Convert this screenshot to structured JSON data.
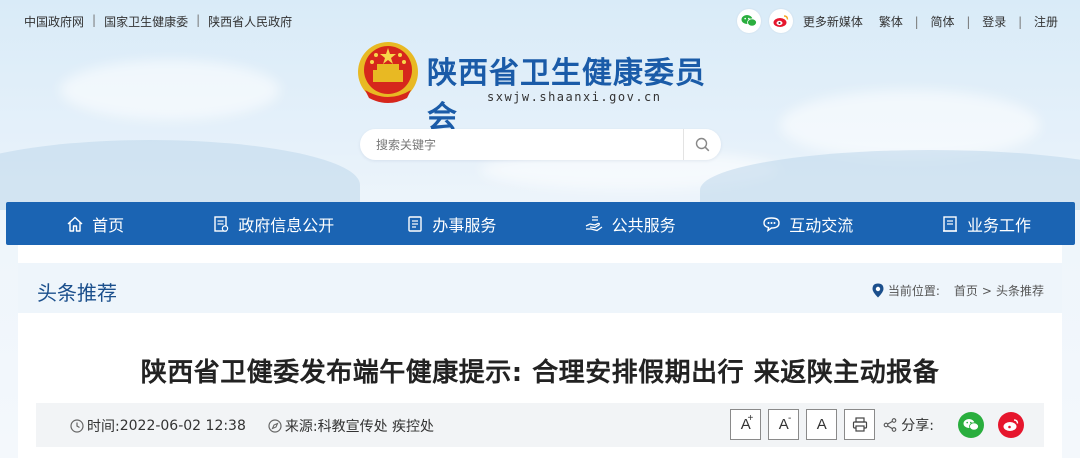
{
  "topbar": {
    "links": [
      "中国政府网",
      "国家卫生健康委",
      "陕西省人民政府"
    ],
    "more_media": "更多新媒体",
    "lang_traditional": "繁体",
    "lang_simplified": "简体",
    "login": "登录",
    "register": "注册"
  },
  "logo": {
    "title": "陕西省卫生健康委员会",
    "domain": "sxwjw.shaanxi.gov.cn"
  },
  "search": {
    "placeholder": "搜索关键字"
  },
  "nav": {
    "items": [
      {
        "label": "首页",
        "icon": "home-icon"
      },
      {
        "label": "政府信息公开",
        "icon": "document-icon"
      },
      {
        "label": "办事服务",
        "icon": "service-icon"
      },
      {
        "label": "公共服务",
        "icon": "public-service-icon"
      },
      {
        "label": "互动交流",
        "icon": "chat-icon"
      },
      {
        "label": "业务工作",
        "icon": "work-icon"
      }
    ]
  },
  "section": {
    "title": "头条推荐"
  },
  "location": {
    "label": "当前位置:",
    "home": "首页",
    "arrow": ">",
    "current": "头条推荐"
  },
  "article": {
    "title": "陕西省卫健委发布端午健康提示: 合理安排假期出行 来返陕主动报备",
    "time_label": "时间:",
    "time_value": "2022-06-02 12:38",
    "source_label": "来源:",
    "source_value": "科教宣传处 疾控处"
  },
  "tools": {
    "font_large": "A",
    "font_large_mark": "+",
    "font_small": "A",
    "font_small_mark": "-",
    "font_default": "A",
    "share_label": "分享:"
  },
  "colors": {
    "nav_bg": "#1b64b3",
    "title_blue": "#1a5ba8",
    "wechat_green": "#2aae3e",
    "weibo_red": "#e6162d"
  }
}
